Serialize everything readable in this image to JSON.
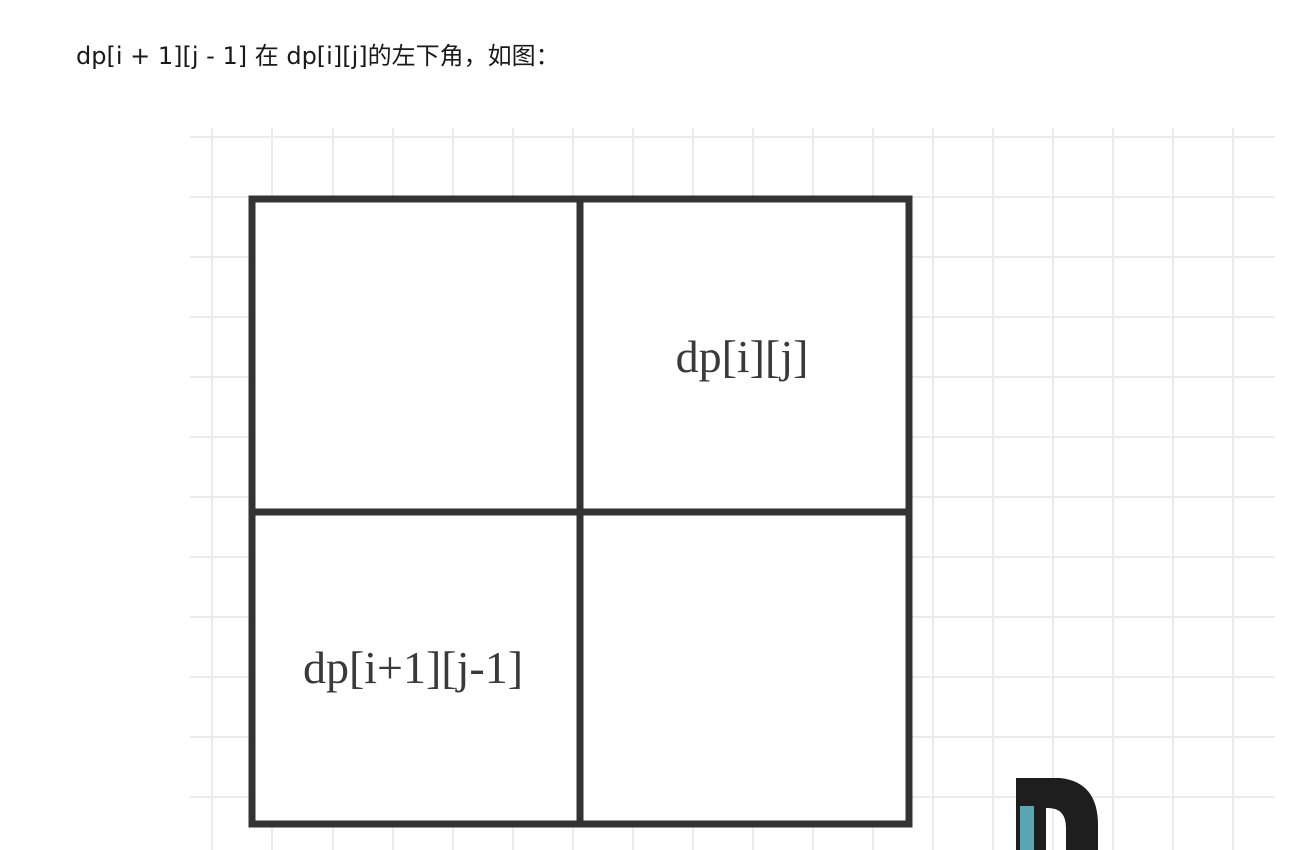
{
  "caption": "dp[i + 1][j - 1] 在 dp[i][j]的左下角，如图：",
  "diagram": {
    "grid_matrix": [
      [
        "",
        "dp[i][j]"
      ],
      [
        "dp[i+1][j-1]",
        ""
      ]
    ],
    "colors": {
      "background_grid": "#ebebeb",
      "cell_border": "#333333",
      "cell_text": "#3a3a3a",
      "logo_dark": "#1e1e1e",
      "logo_teal": "#5aa6b4"
    },
    "logo_icon": "partial-logo-icon"
  }
}
